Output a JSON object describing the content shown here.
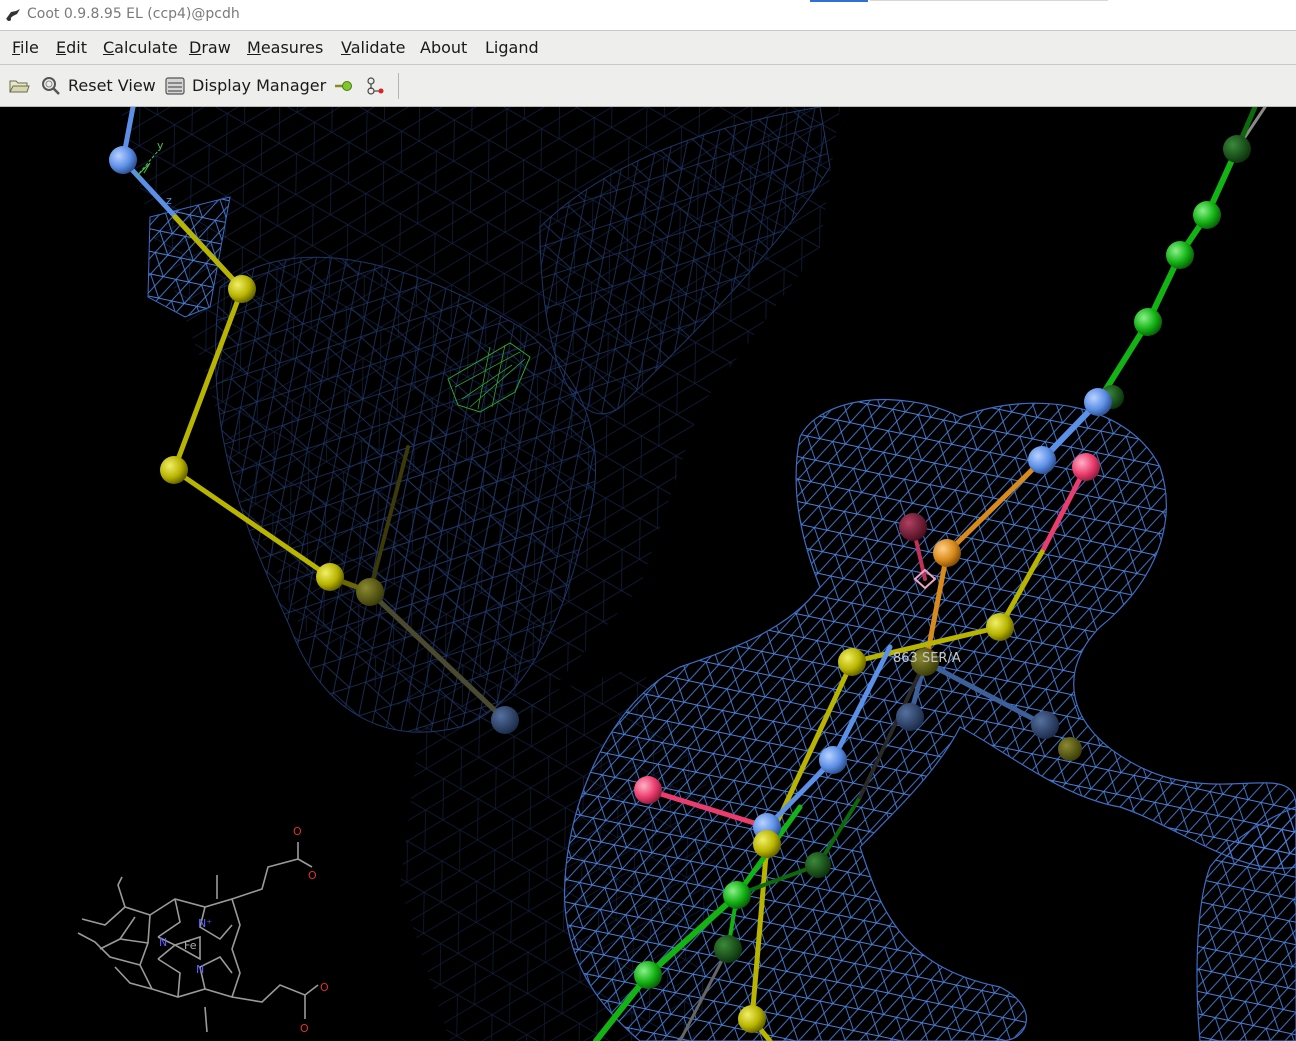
{
  "window": {
    "title": "Coot 0.9.8.95 EL (ccp4)@pcdh"
  },
  "menu": [
    {
      "mnemonic": "F",
      "rest": "ile"
    },
    {
      "mnemonic": "E",
      "rest": "dit"
    },
    {
      "mnemonic": "C",
      "rest": "alculate"
    },
    {
      "mnemonic": "D",
      "rest": "raw"
    },
    {
      "mnemonic": "M",
      "rest": "easures"
    },
    {
      "mnemonic": "V",
      "rest": "alidate"
    },
    {
      "mnemonic": "",
      "rest": "About"
    },
    {
      "mnemonic": "",
      "rest": "Ligand"
    }
  ],
  "toolbar": {
    "open_icon": "folder-open-icon",
    "reset_view_label": "Reset View",
    "display_manager_label": "Display Manager",
    "extra_icons": [
      "go-to-atom-icon",
      "ligand-atom-icon"
    ]
  },
  "viewport": {
    "residue_label": "863 SER/A",
    "axes": {
      "y": "y",
      "z": "z"
    },
    "ligand_atoms": {
      "o1": "O",
      "o2": "O",
      "o3": "O",
      "o4": "O",
      "n1": "N⁺",
      "n2": "N",
      "n3": "N",
      "fe": "Fe"
    },
    "colors": {
      "background": "#000000",
      "map_mesh": "#4a7fd8",
      "diff_map": "#2fa52f",
      "carbon_chain": "#b8b400",
      "nitrogen": "#5c8fe6",
      "oxygen": "#ea3c6e",
      "green_chain": "#13b313",
      "orange_atom": "#d98a1a"
    }
  }
}
